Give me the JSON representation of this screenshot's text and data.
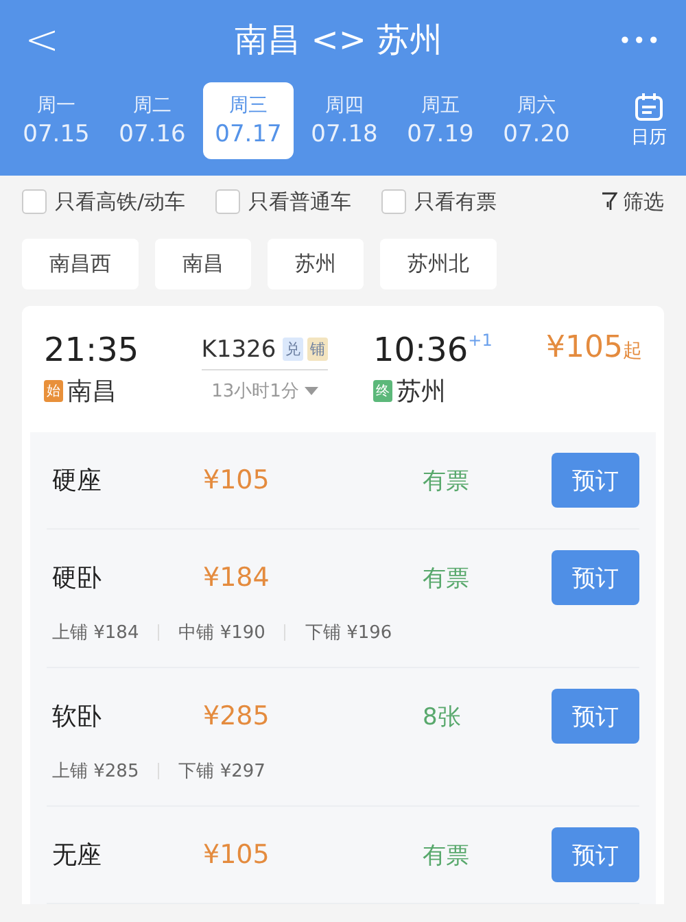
{
  "header": {
    "back": "<",
    "title": "南昌 <> 苏州",
    "more": "•••"
  },
  "dates": [
    {
      "weekday": "周一",
      "date": "07.15",
      "selected": false
    },
    {
      "weekday": "周二",
      "date": "07.16",
      "selected": false
    },
    {
      "weekday": "周三",
      "date": "07.17",
      "selected": true
    },
    {
      "weekday": "周四",
      "date": "07.18",
      "selected": false
    },
    {
      "weekday": "周五",
      "date": "07.19",
      "selected": false
    },
    {
      "weekday": "周六",
      "date": "07.20",
      "selected": false
    }
  ],
  "calendar": {
    "label": "日历"
  },
  "filters": [
    {
      "label": "只看高铁/动车",
      "checked": false
    },
    {
      "label": "只看普通车",
      "checked": false
    },
    {
      "label": "只看有票",
      "checked": false
    }
  ],
  "filter_button": "筛选",
  "stations": [
    "南昌西",
    "南昌",
    "苏州",
    "苏州北"
  ],
  "train": {
    "depart_time": "21:35",
    "depart_tag": "始",
    "depart_station": "南昌",
    "number": "K1326",
    "badges": [
      {
        "text": "兑",
        "color": "#dbe8fb"
      },
      {
        "text": "铺",
        "color": "#f3e4bf"
      }
    ],
    "duration": "13小时1分",
    "arrive_time": "10:36",
    "day_offset": "+1",
    "arrive_tag": "终",
    "arrive_station": "苏州",
    "price": "¥105",
    "price_suffix": "起"
  },
  "seats": [
    {
      "name": "硬座",
      "price": "¥105",
      "availability": "有票",
      "button": "预订"
    },
    {
      "name": "硬卧",
      "price": "¥184",
      "availability": "有票",
      "button": "预订",
      "berths": [
        "上铺 ¥184",
        "中铺 ¥190",
        "下铺 ¥196"
      ]
    },
    {
      "name": "软卧",
      "price": "¥285",
      "availability": "8张",
      "button": "预订",
      "berths": [
        "上铺 ¥285",
        "下铺 ¥297"
      ]
    },
    {
      "name": "无座",
      "price": "¥105",
      "availability": "有票",
      "button": "预订"
    }
  ]
}
